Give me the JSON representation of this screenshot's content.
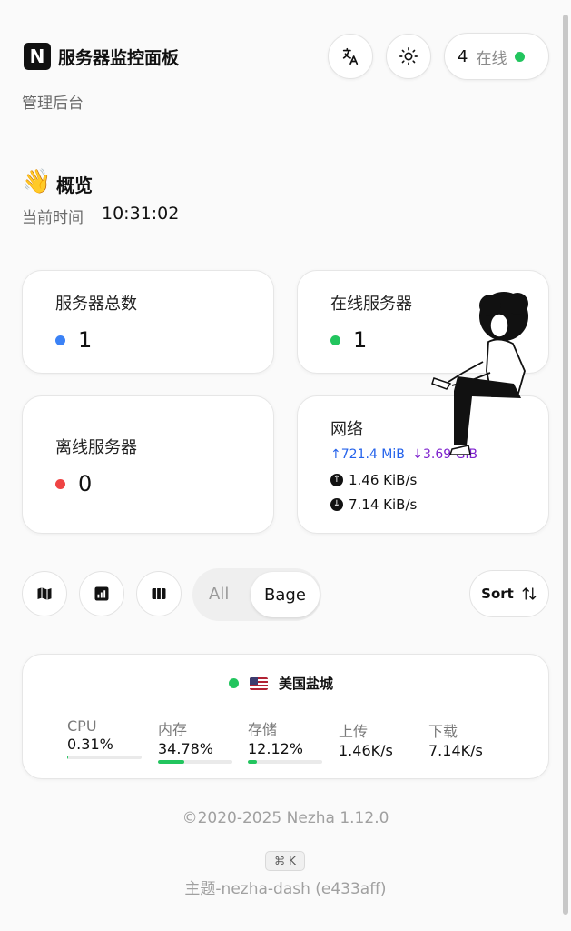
{
  "header": {
    "logo_letter": "N",
    "title": "服务器监控面板",
    "subtitle": "管理后台",
    "online_count": "4",
    "online_label": "在线"
  },
  "overview": {
    "emoji": "👋",
    "title": "概览",
    "time_label": "当前时间",
    "time_value": "10:31:02"
  },
  "stats": {
    "total": {
      "label": "服务器总数",
      "value": "1",
      "color": "#3b82f6"
    },
    "online": {
      "label": "在线服务器",
      "value": "1",
      "color": "#22c55e"
    },
    "offline": {
      "label": "离线服务器",
      "value": "0",
      "color": "#ef4444"
    },
    "network": {
      "label": "网络",
      "total_up": "↑721.4 MiB",
      "total_down": "↓3.69 GiB",
      "speed_up": "1.46 KiB/s",
      "speed_down": "7.14 KiB/s"
    }
  },
  "toolbar": {
    "filter_all": "All",
    "filter_bage": "Bage",
    "sort_label": "Sort"
  },
  "server": {
    "name": "美国盐城",
    "metrics": [
      {
        "label": "CPU",
        "value": "0.31%",
        "percent": 0.31
      },
      {
        "label": "内存",
        "value": "34.78%",
        "percent": 34.78
      },
      {
        "label": "存储",
        "value": "12.12%",
        "percent": 12.12
      },
      {
        "label": "上传",
        "value": "1.46K/s"
      },
      {
        "label": "下载",
        "value": "7.14K/s"
      }
    ]
  },
  "footer": {
    "copyright": "©2020-2025 Nezha 1.12.0",
    "shortcut": "⌘ K",
    "theme": "主题-nezha-dash (e433aff)"
  },
  "colors": {
    "accent": "#22c55e",
    "up": "#2563eb",
    "down": "#7e22ce"
  }
}
